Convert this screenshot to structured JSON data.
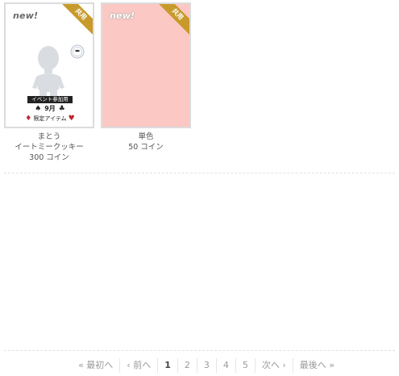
{
  "items": [
    {
      "badge": "new!",
      "ribbon": "共用",
      "event_label": "イベント参加用",
      "month": "9月",
      "limited_label": "限定アイテム",
      "name": "まとう",
      "set_name": "イートミークッキー",
      "price": "300 コイン"
    },
    {
      "badge": "new!",
      "ribbon": "共用",
      "name": "単色",
      "price": "50 コイン",
      "swatch_color": "#fbc8c4"
    }
  ],
  "icons": {
    "avatar": "avatar-silhouette-icon",
    "cookie": "cookie-icon"
  },
  "pagination": {
    "first": "« 最初へ",
    "prev": "‹ 前へ",
    "pages": [
      "1",
      "2",
      "3",
      "4",
      "5"
    ],
    "current": "1",
    "next": "次へ ›",
    "last": "最後へ »"
  },
  "colors": {
    "ribbon": "#c79a2b",
    "card_border": "#dcdcdc",
    "text": "#555555",
    "link": "#999999"
  }
}
